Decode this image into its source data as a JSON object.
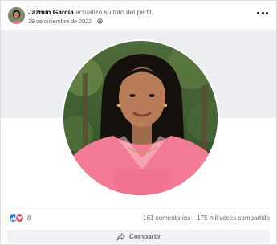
{
  "post": {
    "author_name": "Jazmín García",
    "action_text": "actualizó su foto del perfil.",
    "date": "29 de diciembre de 2022",
    "separator": "·",
    "audience_icon": "globe-icon",
    "more_icon": "more-options-icon"
  },
  "stats": {
    "reaction_icons": [
      "like-icon",
      "love-icon"
    ],
    "reaction_count": "8",
    "comments": "161 comentarios",
    "shares": "175 mil veces compartido"
  },
  "actions": {
    "share_label": "Compartir",
    "share_icon": "share-arrow-icon"
  },
  "colors": {
    "accent": "#1877f2",
    "love": "#f33e58",
    "muted_text": "#65676b",
    "button_bg": "#f0f2f5",
    "photo_bg_top": "#eceef1",
    "shirt": "#f27b93"
  }
}
